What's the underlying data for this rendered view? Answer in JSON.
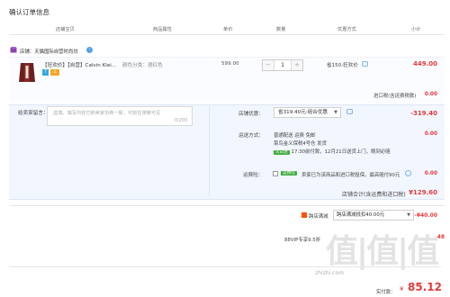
{
  "page": {
    "title": "确认订单信息"
  },
  "columns": [
    "店铺宝贝",
    "商品属性",
    "单价",
    "数量",
    "优惠方式",
    "小计"
  ],
  "shop": {
    "label": "店铺：",
    "name": "天猫国际自营时尚坊",
    "chat_icon": "chat-icon"
  },
  "item": {
    "title": "【狂欢价】【自营】Calvin Klei...",
    "attr": "颜色分类：酒红色",
    "badges": [
      "7",
      "⚠"
    ],
    "price": "599.00",
    "qty": "1",
    "promo": "省150:狂欢价",
    "subtotal": "449.00"
  },
  "tax": {
    "label": "进口税(含运费税款)",
    "value": "0.00"
  },
  "message": {
    "label": "给卖家留言：",
    "placeholder": "选填，填写内容已和卖家协商一致，可前往搜索可见",
    "count": "0/200"
  },
  "shop_discount": {
    "label": "店铺优惠：",
    "selected": "省319.40元:组合优惠",
    "value": "-319.40"
  },
  "shipping": {
    "label": "运送方式：",
    "line1": "普通配送 运费 免邮",
    "line2": "菜鸟金义保税4号仓  发货",
    "line3_tag": "次日达",
    "line3": "17:30前付款，12月21日送货上门，晚到必赔",
    "value": "0.00"
  },
  "insurance": {
    "label": "运费险：",
    "tag": "运费险",
    "text": "卖家已为该商品和进口税投保，最高赔付90元",
    "value": "0.00"
  },
  "shop_total": {
    "label": "店铺合计(含运费和进口税)",
    "value": "¥129.60"
  },
  "tmall": {
    "label": "跨店满减",
    "selected": "跨店满减抵扣40.00元",
    "value": "-¥40.00"
  },
  "vip": {
    "label": "88VIP专享9.5折",
    "value": "48"
  },
  "pay": {
    "label": "实付款：",
    "currency": "¥",
    "value": "85.12"
  },
  "watermark": {
    "big": "值|值|值",
    "site": "zhizhi.com"
  },
  "colors": {
    "accent": "#e4393c",
    "panel": "#f2f7ff",
    "link_blue": "#5b9fe6"
  }
}
